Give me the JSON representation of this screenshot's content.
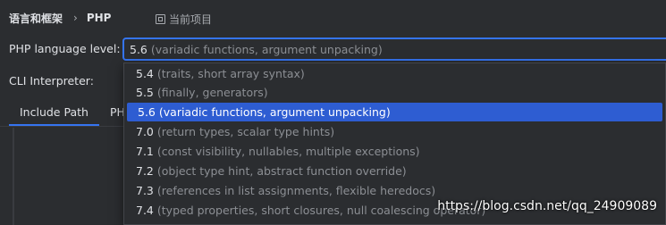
{
  "breadcrumb": {
    "parent": "语言和框架",
    "separator": "›",
    "current": "PHP"
  },
  "project_scope": {
    "icon": "project-scope-icon",
    "label": "当前项目"
  },
  "language_level": {
    "label": "PHP language level:",
    "selected_version": "5.6",
    "selected_description": "(variadic functions, argument unpacking)"
  },
  "cli_interpreter": {
    "label": "CLI Interpreter:"
  },
  "tabs": [
    {
      "label": "Include Path",
      "active": true
    },
    {
      "label": "PHP",
      "active": false
    }
  ],
  "dropdown": {
    "options": [
      {
        "version": "5.4",
        "description": "(traits, short array syntax)"
      },
      {
        "version": "5.5",
        "description": "(finally, generators)"
      },
      {
        "version": "5.6",
        "description": "(variadic functions, argument unpacking)",
        "selected": true
      },
      {
        "version": "7.0",
        "description": "(return types, scalar type hints)"
      },
      {
        "version": "7.1",
        "description": "(const visibility, nullables, multiple exceptions)"
      },
      {
        "version": "7.2",
        "description": "(object type hint, abstract function override)"
      },
      {
        "version": "7.3",
        "description": "(references in list assignments, flexible heredocs)"
      },
      {
        "version": "7.4",
        "description": "(typed properties, short closures, null coalescing operator)"
      }
    ]
  },
  "watermark": "https://blog.csdn.net/qq_24909089",
  "colors": {
    "background": "#2b2d30",
    "accent": "#3574f0",
    "selection": "#2e5dd2",
    "text": "#dfe1e5",
    "muted_text": "#8c8f94"
  }
}
